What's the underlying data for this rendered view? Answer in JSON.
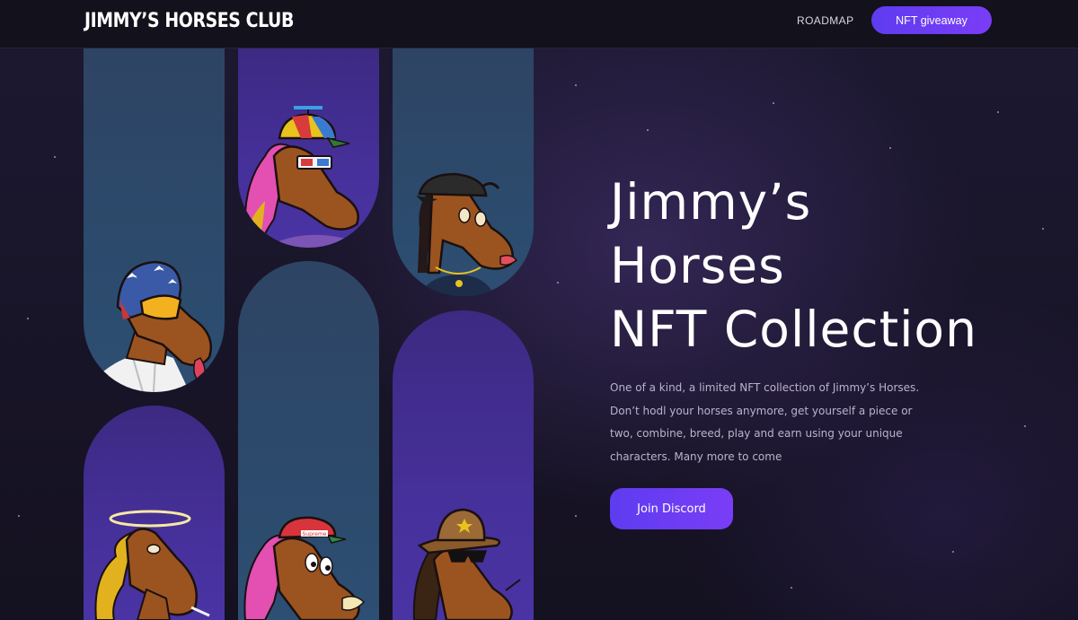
{
  "header": {
    "logo": "JIMMY’S HORSES CLUB",
    "nav_link": "ROADMAP",
    "cta_label": "NFT giveaway"
  },
  "hero": {
    "title_lines": [
      "Jimmy’s",
      "Horses",
      "NFT Collection"
    ],
    "description": "One of a kind, a limited NFT collection of Jimmy’s Horses. Don’t hodl your horses anymore, get yourself a piece or two, combine, breed, play and earn using your unique characters. Many more to come",
    "cta_label": "Join Discord"
  },
  "gallery": {
    "cap_text_supreme": "Supreme",
    "items": [
      {
        "name": "horse-flag-helmet",
        "bg": "blue"
      },
      {
        "name": "horse-propeller-cap",
        "bg": "purple"
      },
      {
        "name": "horse-backwards-cap",
        "bg": "blue"
      },
      {
        "name": "horse-halo",
        "bg": "purple"
      },
      {
        "name": "horse-supreme-cap",
        "bg": "blue"
      },
      {
        "name": "horse-cowboy-hat",
        "bg": "purple"
      }
    ]
  },
  "colors": {
    "accent_start": "#5e3cf0",
    "accent_end": "#7a3df6",
    "nav_bg": "#13111c",
    "hero_bg": "#1a1629",
    "pill_blue": "#2e4a6c",
    "pill_purple": "#44309a",
    "horse_brown": "#9b5420"
  }
}
